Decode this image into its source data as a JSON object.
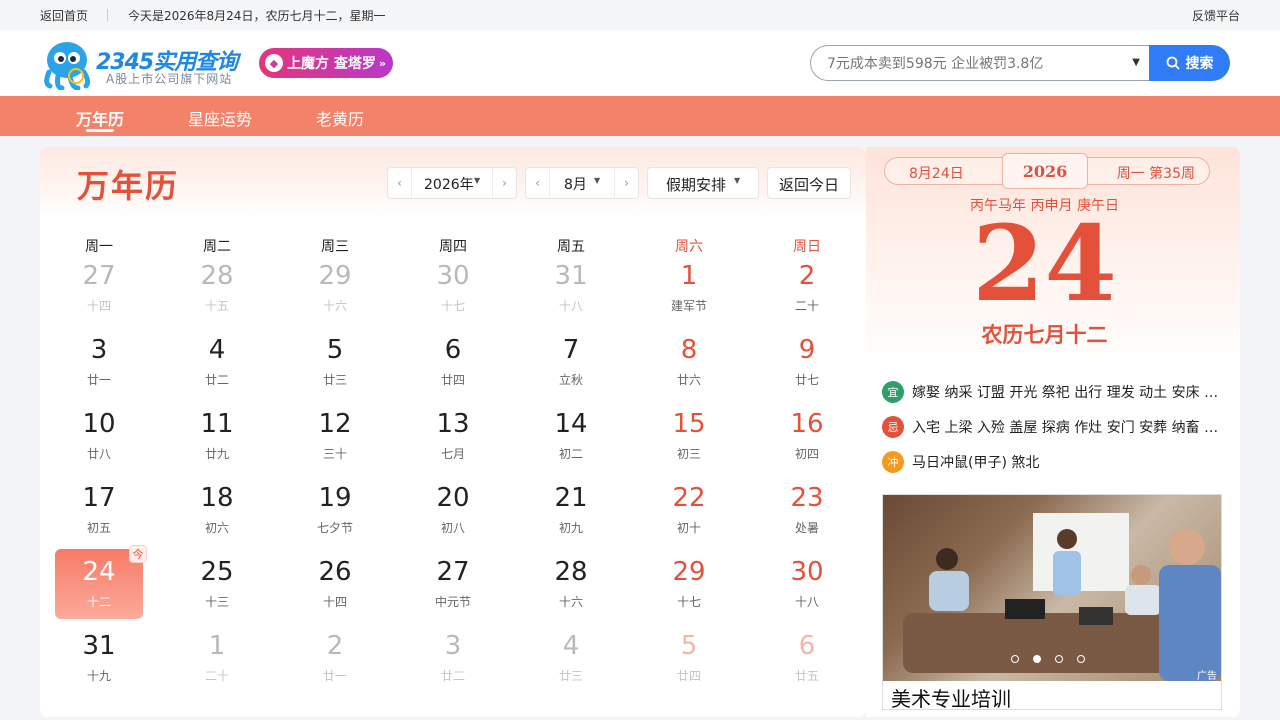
{
  "topbar": {
    "home": "返回首页",
    "today": "今天是2026年8月24日，农历七月十二，星期一",
    "feedback": "反馈平台"
  },
  "header": {
    "brand": "2345实用查询",
    "tagline": "A股上市公司旗下网站",
    "promo": "上魔方 查塔罗",
    "search_placeholder": "7元成本卖到598元 企业被罚3.8亿",
    "search_button": "搜索"
  },
  "nav": {
    "items": [
      "万年历",
      "星座运势",
      "老黄历"
    ]
  },
  "calendar": {
    "title": "万年历",
    "year": "2026年",
    "month": "8月",
    "holiday": "假期安排",
    "back_today": "返回今日",
    "today_tag": "今",
    "weekdays": [
      "周一",
      "周二",
      "周三",
      "周四",
      "周五",
      "周六",
      "周日"
    ],
    "days": [
      {
        "n": "27",
        "l": "十四",
        "o": true
      },
      {
        "n": "28",
        "l": "十五",
        "o": true
      },
      {
        "n": "29",
        "l": "十六",
        "o": true
      },
      {
        "n": "30",
        "l": "十七",
        "o": true
      },
      {
        "n": "31",
        "l": "十八",
        "o": true
      },
      {
        "n": "1",
        "l": "建军节"
      },
      {
        "n": "2",
        "l": "二十"
      },
      {
        "n": "3",
        "l": "廿一"
      },
      {
        "n": "4",
        "l": "廿二"
      },
      {
        "n": "5",
        "l": "廿三"
      },
      {
        "n": "6",
        "l": "廿四"
      },
      {
        "n": "7",
        "l": "立秋"
      },
      {
        "n": "8",
        "l": "廿六"
      },
      {
        "n": "9",
        "l": "廿七"
      },
      {
        "n": "10",
        "l": "廿八"
      },
      {
        "n": "11",
        "l": "廿九"
      },
      {
        "n": "12",
        "l": "三十"
      },
      {
        "n": "13",
        "l": "七月"
      },
      {
        "n": "14",
        "l": "初二"
      },
      {
        "n": "15",
        "l": "初三"
      },
      {
        "n": "16",
        "l": "初四"
      },
      {
        "n": "17",
        "l": "初五"
      },
      {
        "n": "18",
        "l": "初六"
      },
      {
        "n": "19",
        "l": "七夕节"
      },
      {
        "n": "20",
        "l": "初八"
      },
      {
        "n": "21",
        "l": "初九"
      },
      {
        "n": "22",
        "l": "初十"
      },
      {
        "n": "23",
        "l": "处暑"
      },
      {
        "n": "24",
        "l": "十二",
        "sel": true
      },
      {
        "n": "25",
        "l": "十三"
      },
      {
        "n": "26",
        "l": "十四"
      },
      {
        "n": "27",
        "l": "中元节"
      },
      {
        "n": "28",
        "l": "十六"
      },
      {
        "n": "29",
        "l": "十七"
      },
      {
        "n": "30",
        "l": "十八"
      },
      {
        "n": "31",
        "l": "十九"
      },
      {
        "n": "1",
        "l": "二十",
        "o": true
      },
      {
        "n": "2",
        "l": "廿一",
        "o": true
      },
      {
        "n": "3",
        "l": "廿二",
        "o": true
      },
      {
        "n": "4",
        "l": "廿三",
        "o": true
      },
      {
        "n": "5",
        "l": "廿四",
        "o": true
      },
      {
        "n": "6",
        "l": "廿五",
        "o": true
      }
    ]
  },
  "detail": {
    "date": "8月24日",
    "year": "2026",
    "week": "周一 第35周",
    "ganzhi": "丙午马年 丙申月 庚午日",
    "day": "24",
    "lunar": "农历七月十二",
    "yi_icon": "宜",
    "yi": "嫁娶 纳采 订盟 开光 祭祀 出行 理发 动土 安床 放水 开市",
    "ji_icon": "忌",
    "ji": "入宅 上梁 入殓 盖屋 探病 作灶 安门 安葬 纳畜 伐木",
    "chong_icon": "冲",
    "chong": "马日冲鼠(甲子) 煞北"
  },
  "ad": {
    "caption": "美术专业培训",
    "label": "广告"
  },
  "colors": {
    "accent": "#e4513a",
    "nav": "#f3826b",
    "search_button": "#2f7cf6"
  }
}
